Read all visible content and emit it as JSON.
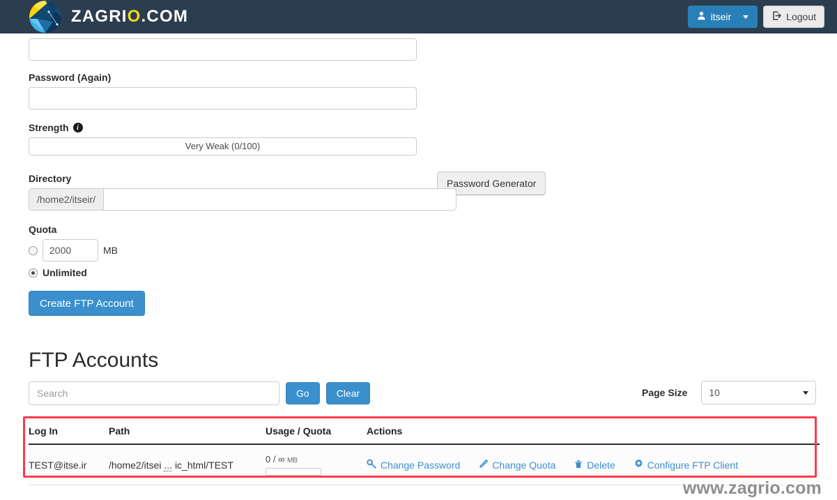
{
  "navbar": {
    "brand_prefix": "ZAGRI",
    "brand_o": "O",
    "brand_suffix": ".COM",
    "user_label": "itseir",
    "logout_label": "Logout",
    "user_icon": "user-icon",
    "logout_icon": "sign-out-icon",
    "background_color": "#2b3e50",
    "user_button_color": "#2980b9"
  },
  "form": {
    "password_value": "",
    "password_again_label": "Password (Again)",
    "password_again_value": "",
    "strength_label": "Strength",
    "strength_info_icon": "info-circle-icon",
    "strength_value": "Very Weak (0/100)",
    "password_generator_label": "Password Generator",
    "directory_label": "Directory",
    "directory_prefix": "/home2/itseir/",
    "directory_value": "",
    "quota_label": "Quota",
    "quota_amount": "2000",
    "quota_unit": "MB",
    "quota_amount_selected": false,
    "quota_unlimited_label": "Unlimited",
    "quota_unlimited_selected": true,
    "create_button_label": "Create FTP Account",
    "primary_color": "#3a8fcc"
  },
  "accounts": {
    "title": "FTP Accounts",
    "search_placeholder": "Search",
    "search_value": "",
    "go_label": "Go",
    "clear_label": "Clear",
    "page_size_label": "Page Size",
    "page_size_value": "10",
    "columns": [
      "Log In",
      "Path",
      "Usage / Quota",
      "Actions"
    ],
    "rows": [
      {
        "login": "TEST@itse.ir",
        "path_start": "/home2/itsei",
        "path_ellipsis": "...",
        "path_end": "ic_html/TEST",
        "usage": "0 / ∞",
        "usage_unit": "MB",
        "usage_percent": 0,
        "actions": [
          {
            "label": "Change Password",
            "icon": "key-icon"
          },
          {
            "label": "Change Quota",
            "icon": "pencil-icon"
          },
          {
            "label": "Delete",
            "icon": "trash-icon"
          },
          {
            "label": "Configure FTP Client",
            "icon": "gear-icon"
          }
        ]
      }
    ],
    "highlight_color": "#fb3b4d"
  },
  "watermark": {
    "text": "www.zagrio.com"
  }
}
